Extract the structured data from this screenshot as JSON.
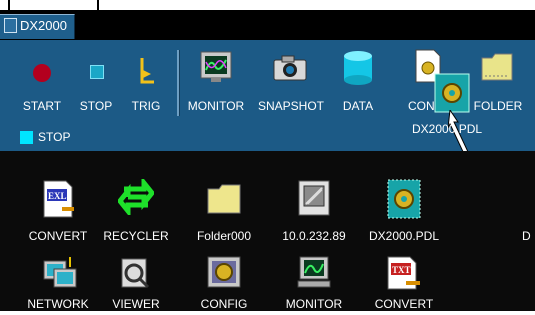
{
  "window": {
    "title": "DX2000"
  },
  "toolbar": {
    "items": [
      {
        "label": "START",
        "icon": "record-icon"
      },
      {
        "label": "STOP",
        "icon": "stop-icon"
      },
      {
        "label": "TRIG",
        "icon": "trigger-icon"
      },
      {
        "label": "MONITOR",
        "icon": "monitor-icon"
      },
      {
        "label": "SNAPSHOT",
        "icon": "camera-icon"
      },
      {
        "label": "DATA",
        "icon": "database-icon"
      },
      {
        "label": "CON",
        "icon": "config-document-icon"
      },
      {
        "label": "FOLDER",
        "icon": "folder-icon"
      }
    ],
    "drag_tooltip": "DX2000.PDL"
  },
  "status": {
    "text": "STOP",
    "color": "#00e5ff"
  },
  "desktop": {
    "row1": [
      {
        "label": "CONVERT",
        "icon": "exl-convert-icon"
      },
      {
        "label": "RECYCLER",
        "icon": "recycle-icon"
      },
      {
        "label": "Folder000",
        "icon": "folder-icon"
      },
      {
        "label": "10.0.232.89",
        "icon": "network-drive-icon"
      },
      {
        "label": "DX2000.PDL",
        "icon": "pdl-file-icon"
      },
      {
        "label": "D",
        "icon": "partial-icon"
      }
    ],
    "row2": [
      {
        "label": "NETWORK",
        "icon": "network-icon"
      },
      {
        "label": "VIEWER",
        "icon": "viewer-icon"
      },
      {
        "label": "CONFIG",
        "icon": "config-icon"
      },
      {
        "label": "MONITOR",
        "icon": "monitor-icon"
      },
      {
        "label": "CONVERT",
        "icon": "txt-convert-icon"
      }
    ]
  },
  "colors": {
    "toolbar": "#1c5a86",
    "background": "#0b0b0b",
    "accent": "#00e5ff"
  }
}
